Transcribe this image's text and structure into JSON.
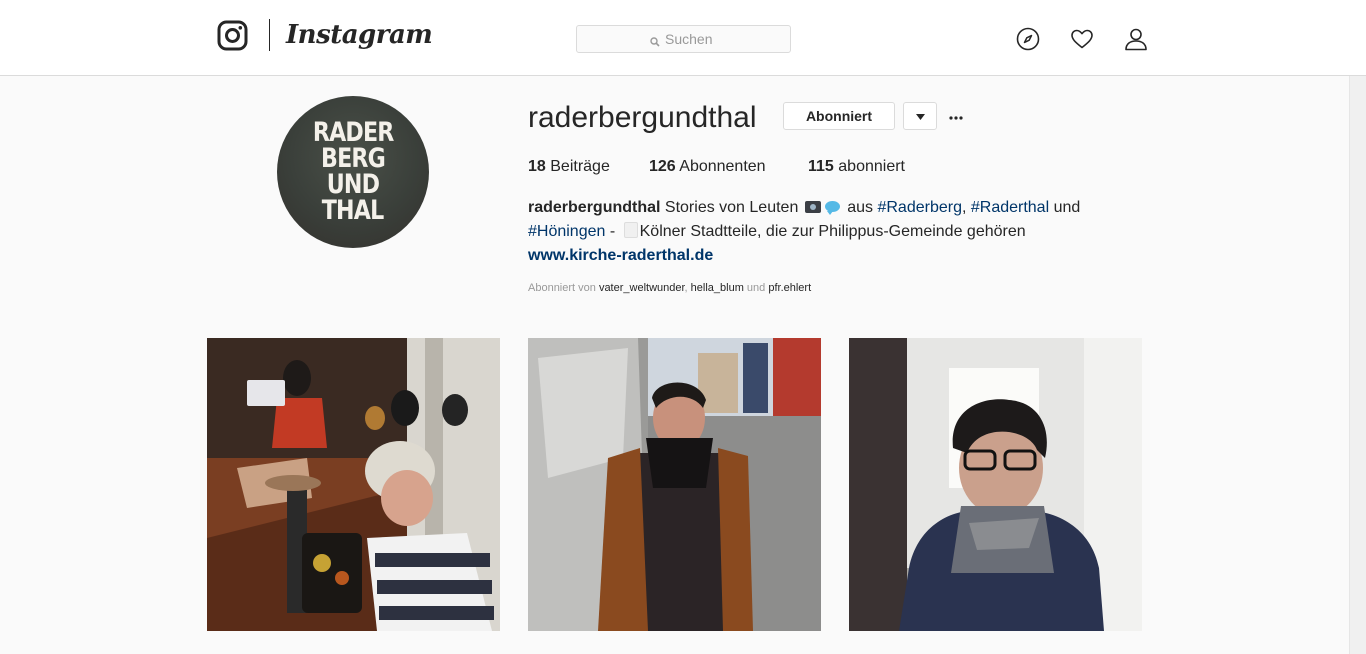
{
  "topnav": {
    "wordmark": "Instagram",
    "search_placeholder": "Suchen",
    "icons": [
      "instagram-camera-icon",
      "search-icon",
      "compass-icon",
      "heart-icon",
      "profile-icon"
    ]
  },
  "profile": {
    "avatar_lines": [
      "RADER",
      "BERG",
      "UND",
      "THAL"
    ],
    "username": "raderbergundthal",
    "follow_button": "Abonniert",
    "stats": [
      {
        "count": "18",
        "label": "Beiträge"
      },
      {
        "count": "126",
        "label": "Abonnenten"
      },
      {
        "count": "115",
        "label": "abonniert"
      }
    ],
    "bio": {
      "name": "raderbergundthal",
      "text_1": " Stories von Leuten ",
      "text_2": " aus ",
      "tag_1": "#Raderberg",
      "sep_1": ", ",
      "tag_2": "#Raderthal",
      "text_3": " und",
      "tag_3": "#Höningen",
      "text_4": " - ",
      "text_5": "Kölner Stadtteile, die zur Philippus-Gemeinde gehören",
      "link": "www.kirche-raderthal.de"
    },
    "followed_by": {
      "prefix": "Abonniert von ",
      "user_1": "vater_weltwunder",
      "sep": ", ",
      "user_2": "hella_blum",
      "and": " und ",
      "user_3": "pfr.ehlert"
    }
  },
  "posts": [
    {
      "alt": "post-1"
    },
    {
      "alt": "post-2"
    },
    {
      "alt": "post-3"
    }
  ],
  "colors": {
    "background": "#fafafa",
    "border": "#dbdbdb",
    "text": "#262626",
    "link": "#003569",
    "muted": "#999999"
  }
}
